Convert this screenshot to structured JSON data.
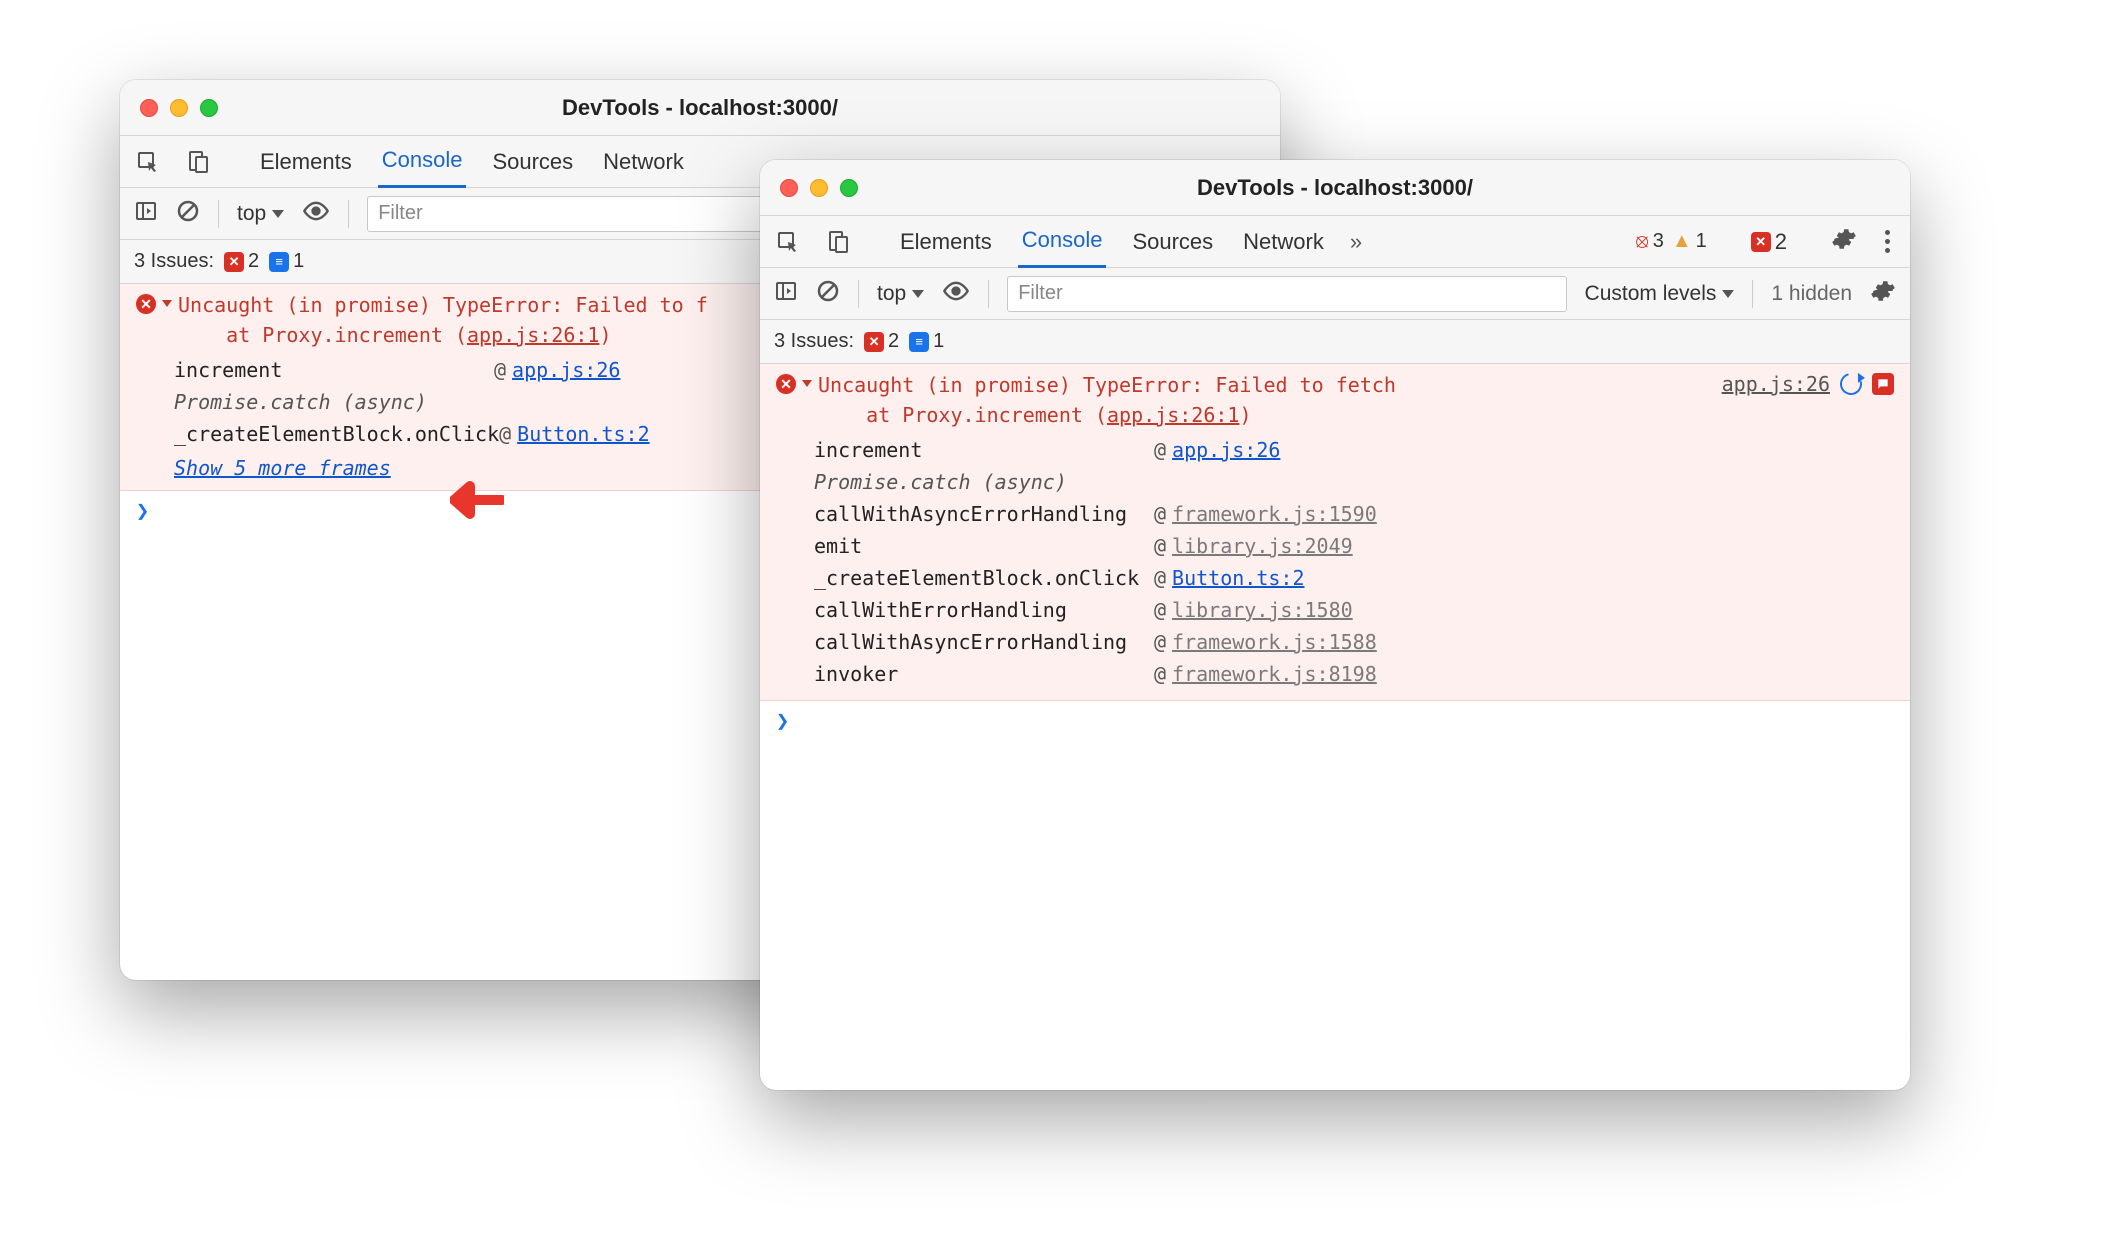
{
  "window1": {
    "title": "DevTools - localhost:3000/",
    "tabs": [
      "Elements",
      "Console",
      "Sources",
      "Network"
    ],
    "active_tab": "Console",
    "toolbar": {
      "context": "top",
      "filter_placeholder": "Filter"
    },
    "issues": {
      "label": "3 Issues:",
      "errors": "2",
      "messages": "1"
    },
    "error": {
      "head_line1": "Uncaught (in promise) TypeError: Failed to f",
      "head_line2": "    at Proxy.increment (",
      "head_loc": "app.js:26:1",
      "head_tail": ")",
      "frames": [
        {
          "fn": "increment",
          "loc": "app.js:26",
          "muted": false
        },
        {
          "fn": "Promise.catch (async)",
          "italic": true
        },
        {
          "fn": "_createElementBlock.onClick",
          "loc": "Button.ts:2",
          "muted": false
        }
      ],
      "show_more": "Show 5 more frames"
    }
  },
  "window2": {
    "title": "DevTools - localhost:3000/",
    "tabs": [
      "Elements",
      "Console",
      "Sources",
      "Network"
    ],
    "active_tab": "Console",
    "badges": {
      "errors": "3",
      "warnings": "1",
      "x_errors": "2"
    },
    "toolbar": {
      "context": "top",
      "filter_placeholder": "Filter",
      "level": "Custom levels",
      "hidden": "1 hidden"
    },
    "issues": {
      "label": "3 Issues:",
      "errors": "2",
      "messages": "1"
    },
    "error": {
      "head_line1": "Uncaught (in promise) TypeError: Failed to fetch",
      "head_line2": "    at Proxy.increment (",
      "head_loc": "app.js:26:1",
      "head_tail": ")",
      "right_loc": "app.js:26",
      "frames": [
        {
          "fn": "increment",
          "loc": "app.js:26",
          "muted": false
        },
        {
          "fn": "Promise.catch (async)",
          "italic": true
        },
        {
          "fn": "callWithAsyncErrorHandling",
          "loc": "framework.js:1590",
          "muted": true
        },
        {
          "fn": "emit",
          "loc": "library.js:2049",
          "muted": true
        },
        {
          "fn": "_createElementBlock.onClick",
          "loc": "Button.ts:2",
          "muted": false
        },
        {
          "fn": "callWithErrorHandling",
          "loc": "library.js:1580",
          "muted": true
        },
        {
          "fn": "callWithAsyncErrorHandling",
          "loc": "framework.js:1588",
          "muted": true
        },
        {
          "fn": "invoker",
          "loc": "framework.js:8198",
          "muted": true
        }
      ]
    }
  }
}
